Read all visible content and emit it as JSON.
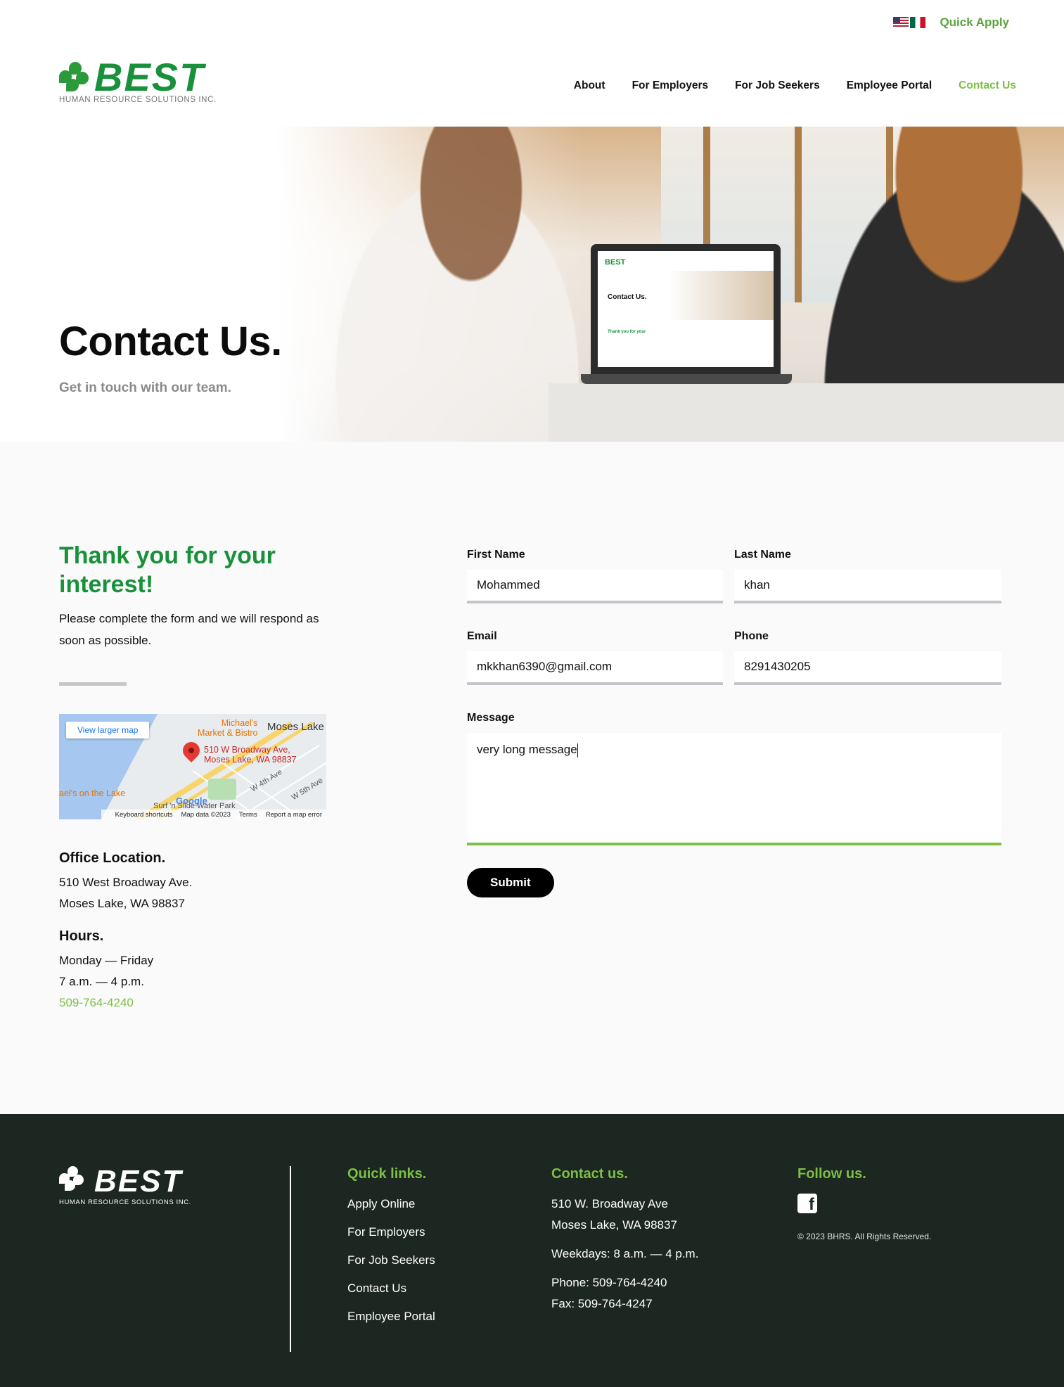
{
  "utility": {
    "quick_apply": "Quick Apply"
  },
  "logo": {
    "word": "BEST",
    "sub": "HUMAN RESOURCE SOLUTIONS INC."
  },
  "nav": {
    "items": [
      "About",
      "For Employers",
      "For Job Seekers",
      "Employee Portal",
      "Contact Us"
    ],
    "active": "Contact Us"
  },
  "hero": {
    "title": "Contact Us.",
    "subtitle": "Get in touch with our team.",
    "laptop": {
      "logo": "BEST",
      "title": "Contact Us.",
      "green": "Thank you for your"
    }
  },
  "intro": {
    "title": "Thank you for your interest!",
    "text": "Please complete the form and we will respond as soon as possible."
  },
  "map": {
    "button": "View larger map",
    "address_line1": "510 W Broadway Ave,",
    "address_line2": "Moses Lake, WA 98837",
    "poi_line1": "Michael's",
    "poi_line2": "Market & Bistro",
    "city": "Moses Lake",
    "lake": "ael's on the Lake",
    "street1": "W 4th Ave",
    "street2": "W 5th Ave",
    "park": "Surf 'n Slide Water Park",
    "google": "Google",
    "footer": [
      "Keyboard shortcuts",
      "Map data ©2023",
      "Terms",
      "Report a map error"
    ]
  },
  "office": {
    "title": "Office Location.",
    "line1": "510 West Broadway Ave.",
    "line2": "Moses Lake, WA 98837"
  },
  "hours": {
    "title": "Hours.",
    "days": "Monday — Friday",
    "time": "7 a.m. — 4 p.m.",
    "phone": "509-764-4240"
  },
  "form": {
    "first_name": {
      "label": "First Name",
      "value": "Mohammed"
    },
    "last_name": {
      "label": "Last Name",
      "value": "khan"
    },
    "email": {
      "label": "Email",
      "value": "mkkhan6390@gmail.com"
    },
    "phone": {
      "label": "Phone",
      "value": "8291430205"
    },
    "message": {
      "label": "Message",
      "value": "very long message"
    },
    "submit": "Submit"
  },
  "footer": {
    "quick_links": {
      "title": "Quick links.",
      "items": [
        "Apply Online",
        "For Employers",
        "For Job Seekers",
        "Contact Us",
        "Employee Portal"
      ]
    },
    "contact": {
      "title": "Contact us.",
      "address1": "510 W. Broadway Ave",
      "address2": "Moses Lake, WA 98837",
      "hours": "Weekdays: 8 a.m. — 4 p.m.",
      "phone": "Phone: 509-764-4240",
      "fax": "Fax: 509-764-4247"
    },
    "follow": {
      "title": "Follow us.",
      "icon": "facebook-icon",
      "copyright": "© 2023 BHRS. All Rights Reserved."
    }
  },
  "colors": {
    "brand_green": "#19913b",
    "accent_green": "#7dbf45",
    "footer_bg": "#1b2720"
  }
}
